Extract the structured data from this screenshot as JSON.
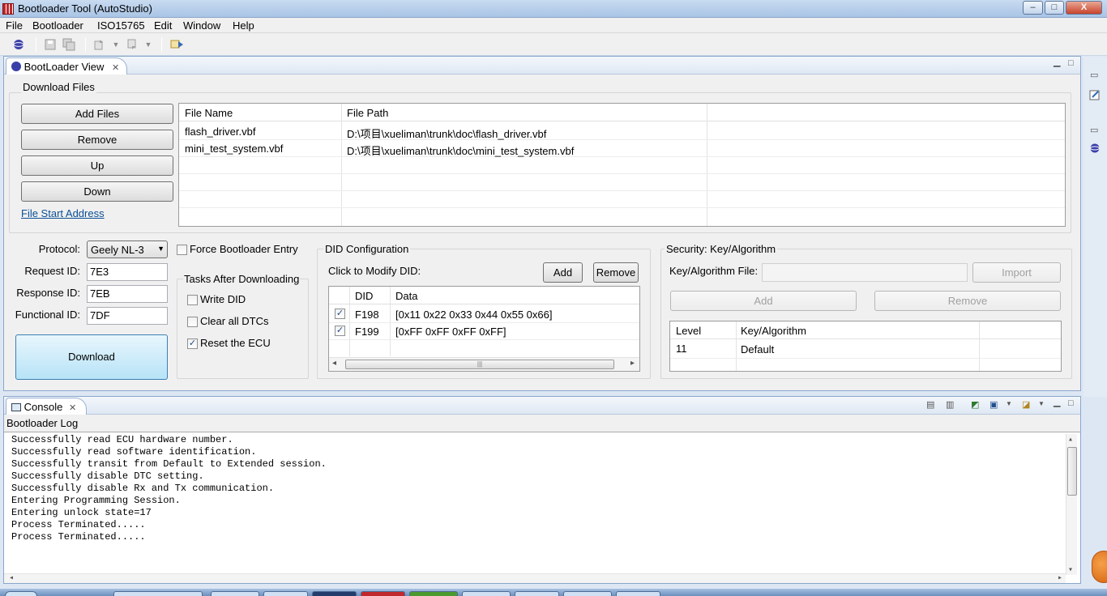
{
  "window": {
    "title": "Bootloader Tool (AutoStudio)",
    "minimize": "–",
    "maximize": "□",
    "close": "X"
  },
  "menu": [
    "File",
    "Bootloader",
    "ISO15765",
    "Edit",
    "Window",
    "Help"
  ],
  "bootloader_view": {
    "tab_label": "BootLoader View",
    "tab_close": "✕",
    "download_files": {
      "group_label": "Download Files",
      "buttons": {
        "add_files": "Add Files",
        "remove": "Remove",
        "up": "Up",
        "down": "Down"
      },
      "link_file_start_address": "File Start Address",
      "columns": [
        "File Name",
        "File Path"
      ],
      "rows": [
        {
          "name": "flash_driver.vbf",
          "path": "D:\\项目\\xueliman\\trunk\\doc\\flash_driver.vbf"
        },
        {
          "name": "mini_test_system.vbf",
          "path": "D:\\项目\\xueliman\\trunk\\doc\\mini_test_system.vbf"
        }
      ]
    },
    "protocol": {
      "protocol_label": "Protocol:",
      "protocol_value": "Geely NL-3",
      "request_id_label": "Request ID:",
      "request_id_value": "7E3",
      "response_id_label": "Response ID:",
      "response_id_value": "7EB",
      "functional_id_label": "Functional ID:",
      "functional_id_value": "7DF",
      "download_button": "Download"
    },
    "force_bootloader_entry": {
      "label": "Force Bootloader Entry",
      "checked": false
    },
    "tasks_after_downloading": {
      "group_label": "Tasks After Downloading",
      "items": [
        {
          "label": "Write DID",
          "checked": false
        },
        {
          "label": "Clear all DTCs",
          "checked": false
        },
        {
          "label": "Reset the ECU",
          "checked": true
        }
      ]
    },
    "did_configuration": {
      "group_label": "DID Configuration",
      "hint": "Click to Modify DID:",
      "add_button": "Add",
      "remove_button": "Remove",
      "columns": [
        "DID",
        "Data"
      ],
      "rows": [
        {
          "checked": true,
          "did": "F198",
          "data": "[0x11 0x22 0x33 0x44 0x55 0x66]"
        },
        {
          "checked": true,
          "did": "F199",
          "data": "[0xFF 0xFF 0xFF 0xFF]"
        }
      ],
      "scroll_grip": "|||"
    },
    "security": {
      "group_label": "Security: Key/Algorithm",
      "file_label": "Key/Algorithm File:",
      "file_value": "",
      "import_button": "Import",
      "add_button": "Add",
      "remove_button": "Remove",
      "columns": [
        "Level",
        "Key/Algorithm"
      ],
      "rows": [
        {
          "level": "11",
          "algorithm": "Default"
        }
      ]
    }
  },
  "console": {
    "tab_label": "Console",
    "tab_close": "✕",
    "log_title": "Bootloader Log",
    "lines": [
      "Successfully read ECU hardware number.",
      "Successfully read software identification.",
      "Successfully transit from Default to Extended session.",
      "Successfully disable DTC setting.",
      "Successfully disable Rx and Tx communication.",
      "Entering Programming Session.",
      "Entering unlock state=17",
      "Process Terminated.....",
      "Process Terminated....."
    ]
  },
  "icons": {
    "scroll_up": "▴",
    "scroll_down": "▾",
    "scroll_left": "◂",
    "scroll_right": "▸",
    "dropdown": "▼"
  }
}
